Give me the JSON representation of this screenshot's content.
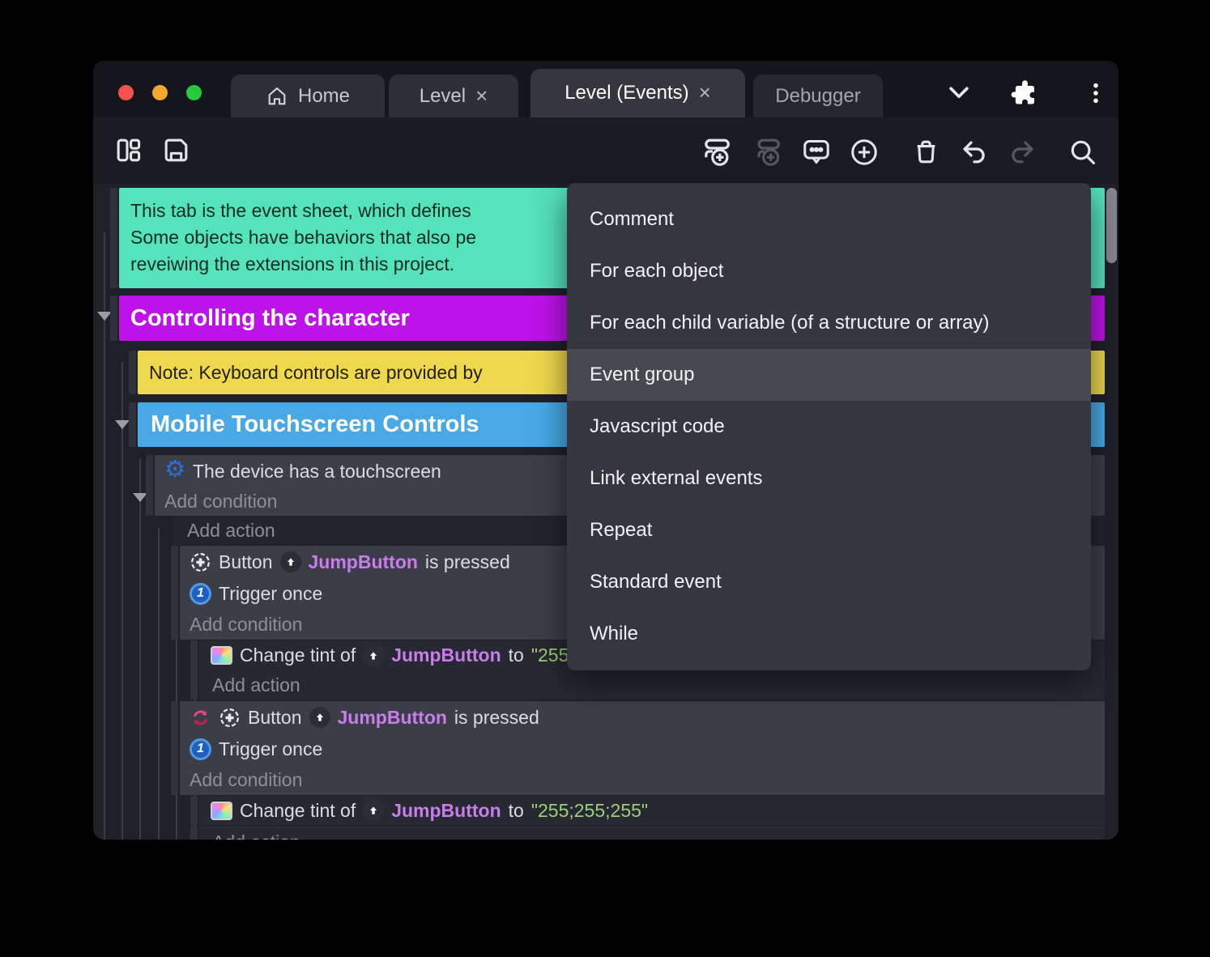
{
  "window_controls": {
    "close_color": "#f4534e",
    "minimize_color": "#f3a72e",
    "maximize_color": "#27c93f"
  },
  "tabs": [
    {
      "label": "Home",
      "active": false
    },
    {
      "label": "Level",
      "active": false,
      "close": "×"
    },
    {
      "label": "Level (Events)",
      "active": true,
      "close": "×"
    },
    {
      "label": "Debugger",
      "active": false
    }
  ],
  "context_menu": {
    "items": [
      "Comment",
      "For each object",
      "For each child variable (of a structure or array)",
      "Event group",
      "Javascript code",
      "Link external events",
      "Repeat",
      "Standard event",
      "While"
    ],
    "highlighted_item": "Event group",
    "highlighted_index": 3
  },
  "event_sheet": {
    "labels": {
      "add_condition": "Add condition",
      "add_action": "Add action"
    },
    "comment": {
      "lines": [
        "This tab is the event sheet, which defines",
        "Some objects have behaviors that also pe",
        "reveiwing the extensions in this project."
      ]
    },
    "group_controlling": {
      "title": "Controlling the character"
    },
    "note": {
      "text": "Note: Keyboard controls are provided by"
    },
    "group_mobile": {
      "title": "Mobile Touchscreen Controls"
    },
    "touch_event": {
      "condition": "The device has a touchscreen"
    },
    "jump_event": {
      "object": "Button",
      "instance": "JumpButton",
      "condition_suffix": "is pressed",
      "trigger": "Trigger once"
    },
    "tint_action": {
      "verb": "Change tint of",
      "instance": "JumpButton",
      "to": "to",
      "value": "\"255;255;255\""
    }
  },
  "icons": {
    "home-icon": "house outline",
    "close-icon": "×",
    "chevron-down-icon": "v",
    "puzzle-icon": "puzzle piece",
    "kebab-menu-icon": "⋮",
    "layout-icon": "panel layout",
    "save-icon": "floppy disk",
    "play-icon": "play triangle",
    "dropdown-caret-icon": "▾",
    "globe-icon": "globe",
    "add-event-icon": "rows with plus",
    "add-subevent-icon": "rows with plus (disabled)",
    "comment-bubble-icon": "speech bubble with dots",
    "plus-circle-icon": "⊕",
    "trash-icon": "trash can",
    "undo-icon": "undo arrow",
    "redo-icon": "redo arrow (disabled)",
    "search-icon": "magnifier",
    "gear-icon": "⚙",
    "dpad-button-icon": "circle with cross",
    "up-arrow-badge-icon": "up arrow in circle",
    "trigger-once-icon": "1 in circle",
    "palette-icon": "rainbow swatch",
    "swap-arrows-icon": "two red curved arrows"
  },
  "colors": {
    "accent_button": "#5a39d6",
    "comment_green": "#55e3b9",
    "group_purple": "#bd13e8",
    "note_yellow": "#eed84e",
    "group_blue": "#48a9e6",
    "object_violet": "#c87de9",
    "string_green": "#9ed077",
    "menu_bg": "#36373e",
    "menu_highlight": "#48494f"
  }
}
